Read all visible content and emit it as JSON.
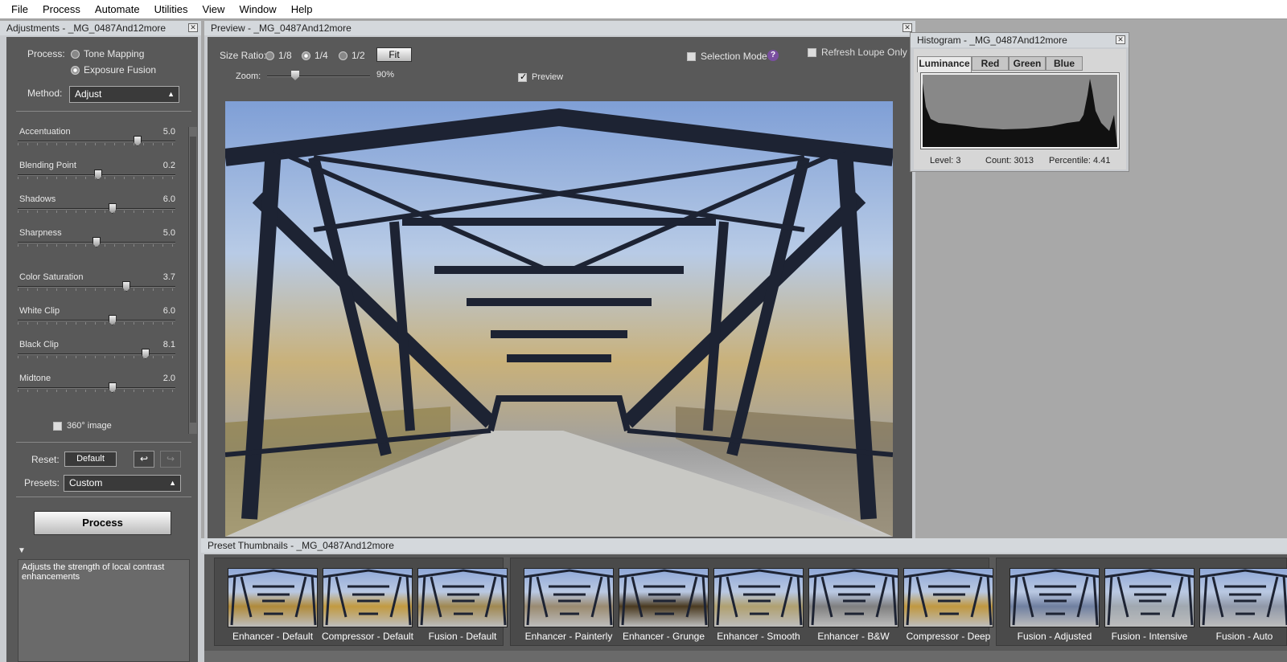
{
  "menu": [
    "File",
    "Process",
    "Automate",
    "Utilities",
    "View",
    "Window",
    "Help"
  ],
  "adjustments": {
    "title": "Adjustments - _MG_0487And12more",
    "process_label": "Process:",
    "process_options": [
      "Tone Mapping",
      "Exposure Fusion"
    ],
    "method_label": "Method:",
    "method_value": "Adjust",
    "sliders": [
      {
        "label": "Accentuation",
        "value": "5.0",
        "fraction": 0.76
      },
      {
        "label": "Blending Point",
        "value": "0.2",
        "fraction": 0.51
      },
      {
        "label": "Shadows",
        "value": "6.0",
        "fraction": 0.6
      },
      {
        "label": "Sharpness",
        "value": "5.0",
        "fraction": 0.5
      },
      {
        "label": "Color Saturation",
        "value": "3.7",
        "fraction": 0.69
      },
      {
        "label": "White Clip",
        "value": "6.0",
        "fraction": 0.6
      },
      {
        "label": "Black Clip",
        "value": "8.1",
        "fraction": 0.81
      },
      {
        "label": "Midtone",
        "value": "2.0",
        "fraction": 0.6
      }
    ],
    "image360_label": "360° image",
    "reset_label": "Reset:",
    "default_btn": "Default",
    "presets_label": "Presets:",
    "presets_value": "Custom",
    "process_btn": "Process",
    "description": "Adjusts the strength of local contrast enhancements"
  },
  "preview": {
    "title": "Preview - _MG_0487And12more",
    "size_ratio_label": "Size Ratio:",
    "ratios": [
      "1/8",
      "1/4",
      "1/2"
    ],
    "fit_btn": "Fit",
    "selection_mode_label": "Selection Mode",
    "refresh_loupe_label": "Refresh Loupe Only",
    "zoom_label": "Zoom:",
    "zoom_value": "90%",
    "preview_label": "Preview"
  },
  "histogram": {
    "title": "Histogram - _MG_0487And12more",
    "tabs": [
      "Luminance",
      "Red",
      "Green",
      "Blue"
    ],
    "level": "Level: 3",
    "count": "Count: 3013",
    "percentile": "Percentile: 4.41"
  },
  "thumbnails": {
    "title": "Preset Thumbnails - _MG_0487And12more",
    "groups": [
      [
        "Enhancer - Default",
        "Compressor - Default",
        "Fusion - Default"
      ],
      [
        "Enhancer - Painterly",
        "Enhancer - Grunge",
        "Enhancer - Smooth",
        "Enhancer - B&W",
        "Compressor - Deep"
      ],
      [
        "Fusion - Adjusted",
        "Fusion - Intensive",
        "Fusion - Auto"
      ]
    ]
  }
}
